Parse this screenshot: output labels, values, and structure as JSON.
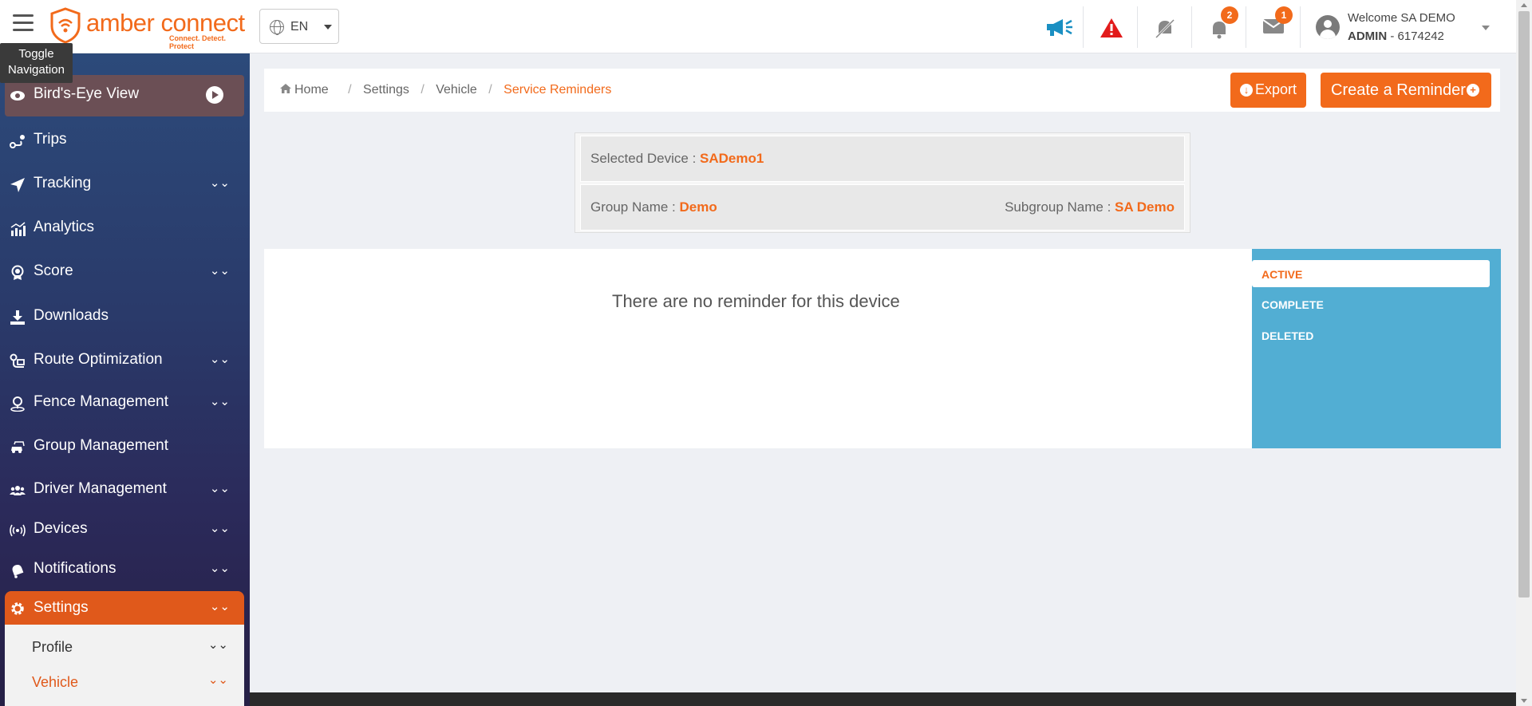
{
  "header": {
    "toggle_tooltip": "Toggle Navigation",
    "brand_name": "amber connect",
    "brand_tagline": "Connect. Detect. Protect",
    "language": "EN",
    "icons": {
      "announcement": "megaphone-icon",
      "alert": "warning-icon",
      "muted": "bell-slash-icon",
      "notifications": "bell-icon",
      "messages": "envelope-icon"
    },
    "notification_count": "2",
    "message_count": "1",
    "user_welcome": "Welcome SA DEMO",
    "user_role": "ADMIN",
    "user_id": " - 6174242",
    "accent_color": "#f26a1b"
  },
  "sidebar": {
    "items": [
      {
        "label": "Bird's-Eye View",
        "icon": "eye-icon"
      },
      {
        "label": "Trips",
        "icon": "route-icon"
      },
      {
        "label": "Tracking",
        "icon": "location-arrow-icon"
      },
      {
        "label": "Analytics",
        "icon": "chart-icon"
      },
      {
        "label": "Score",
        "icon": "award-icon"
      },
      {
        "label": "Downloads",
        "icon": "download-icon"
      },
      {
        "label": "Route Optimization",
        "icon": "route-map-icon"
      },
      {
        "label": "Fence Management",
        "icon": "map-pin-icon"
      },
      {
        "label": "Group Management",
        "icon": "car-group-icon"
      },
      {
        "label": "Driver Management",
        "icon": "users-icon"
      },
      {
        "label": "Devices",
        "icon": "broadcast-icon"
      },
      {
        "label": "Notifications",
        "icon": "bell-icon"
      },
      {
        "label": "Settings",
        "icon": "gear-icon"
      }
    ],
    "chevron": "»",
    "submenu": [
      {
        "label": "Profile"
      },
      {
        "label": "Vehicle"
      }
    ]
  },
  "breadcrumb": {
    "home": "Home",
    "settings": "Settings",
    "vehicle": "Vehicle",
    "current": "Service Reminders",
    "separator": "/"
  },
  "actions": {
    "export_label": "Export",
    "create_label": "Create a Reminder"
  },
  "device": {
    "selected_label": "Selected Device : ",
    "selected_value": "SADemo1",
    "group_label": "Group Name : ",
    "group_value": "Demo",
    "subgroup_label": "Subgroup Name : ",
    "subgroup_value": "SA Demo"
  },
  "reminders": {
    "empty_message": "There are no reminder for this device",
    "tabs": [
      "ACTIVE",
      "COMPLETE",
      "DELETED"
    ],
    "tab_color": "#52aed3"
  }
}
